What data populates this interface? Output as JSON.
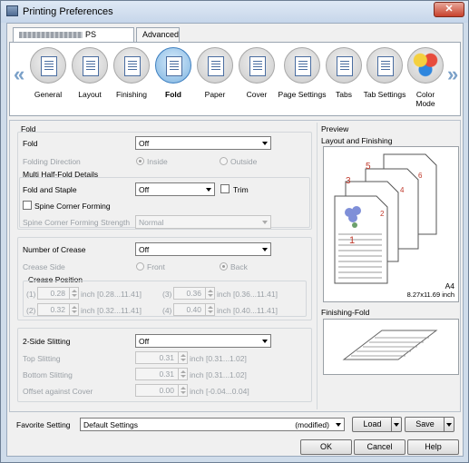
{
  "window": {
    "title": "Printing Preferences",
    "close_label": "✕"
  },
  "top_tabs": [
    {
      "label": "PS"
    },
    {
      "label": "Advanced"
    }
  ],
  "ribbon": {
    "items": [
      {
        "label": "General"
      },
      {
        "label": "Layout"
      },
      {
        "label": "Finishing"
      },
      {
        "label": "Fold"
      },
      {
        "label": "Paper"
      },
      {
        "label": "Cover"
      },
      {
        "label": "Page Settings"
      },
      {
        "label": "Tabs"
      },
      {
        "label": "Tab Settings"
      },
      {
        "label": "Color Mode"
      }
    ],
    "left_arrow": "«",
    "right_arrow": "»"
  },
  "fold": {
    "section_title": "Fold",
    "fold_label": "Fold",
    "fold_value": "Off",
    "folding_direction_label": "Folding Direction",
    "inside_label": "Inside",
    "outside_label": "Outside",
    "multi_half_fold_label": "Multi Half-Fold Details",
    "fold_staple_label": "Fold and Staple",
    "fold_staple_value": "Off",
    "trim_label": "Trim",
    "spine_corner_label": "Spine Corner Forming",
    "spine_strength_label": "Spine Corner Forming Strength",
    "spine_strength_value": "Normal"
  },
  "crease": {
    "number_label": "Number of Crease",
    "number_value": "Off",
    "side_label": "Crease Side",
    "front_label": "Front",
    "back_label": "Back",
    "position_label": "Crease Position",
    "positions": [
      {
        "index": "(1)",
        "value": "0.28",
        "range": "inch [0.28...11.41]"
      },
      {
        "index": "(2)",
        "value": "0.32",
        "range": "inch [0.32...11.41]"
      },
      {
        "index": "(3)",
        "value": "0.36",
        "range": "inch [0.36...11.41]"
      },
      {
        "index": "(4)",
        "value": "0.40",
        "range": "inch [0.40...11.41]"
      }
    ]
  },
  "slitting": {
    "label": "2-Side Slitting",
    "value": "Off",
    "top_label": "Top Slitting",
    "top_value": "0.31",
    "top_range": "inch [0.31...1.02]",
    "bottom_label": "Bottom Slitting",
    "bottom_value": "0.31",
    "bottom_range": "inch [0.31...1.02]",
    "offset_label": "Offset against Cover",
    "offset_value": "0.00",
    "offset_range": "inch [-0.04...0.04]"
  },
  "preview": {
    "title": "Preview",
    "layout_label": "Layout and Finishing",
    "page_numbers": [
      "1",
      "2",
      "3",
      "4",
      "5",
      "6"
    ],
    "paper_size": "A4",
    "paper_dims": "8.27x11.69 inch",
    "finishing_fold_label": "Finishing-Fold"
  },
  "favorite": {
    "label": "Favorite Setting",
    "value": "Default Settings",
    "modified": "(modified)",
    "load_label": "Load",
    "save_label": "Save"
  },
  "buttons": {
    "ok": "OK",
    "cancel": "Cancel",
    "help": "Help"
  },
  "colors": {
    "accent": "#3d7fc0",
    "window_frame": "#cfdcea",
    "page_number": "#c0392b"
  }
}
